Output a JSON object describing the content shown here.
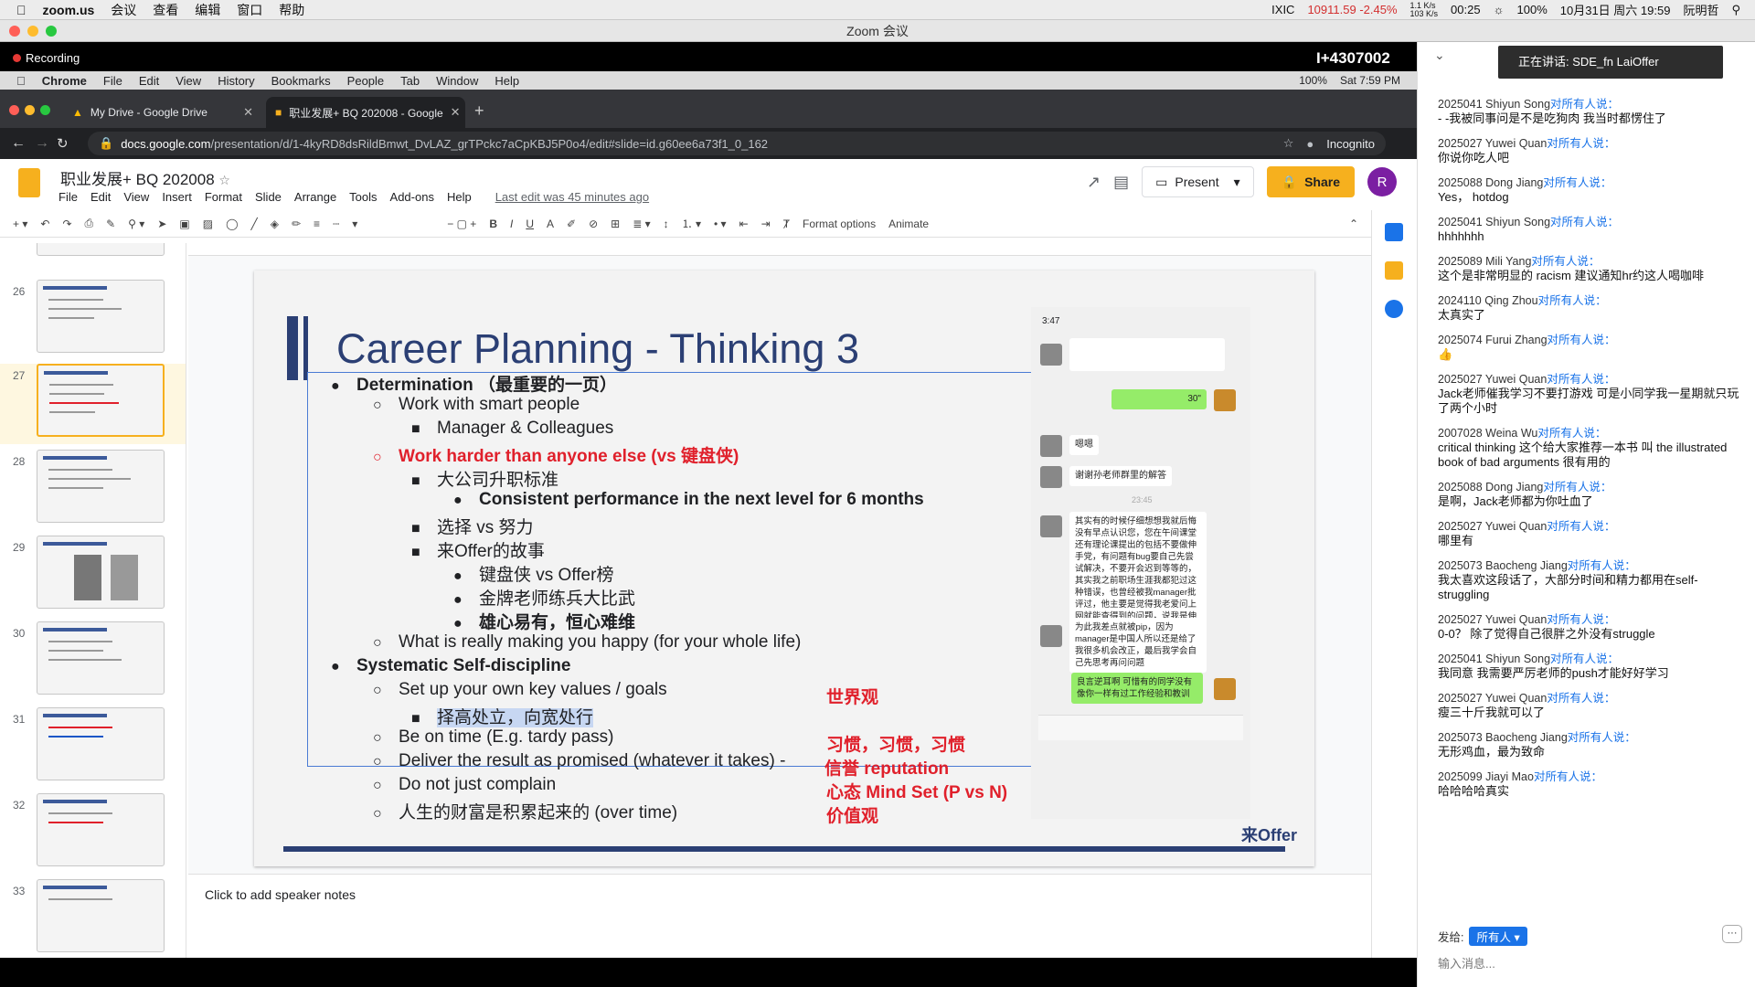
{
  "mac_menu": {
    "app": "zoom.us",
    "items": [
      "会议",
      "查看",
      "编辑",
      "窗口",
      "帮助"
    ],
    "ixic_label": "IXIC",
    "ixic_value": "10911.59 -2.45%",
    "net_up": "1.1 K/s",
    "net_down": "103 K/s",
    "timer": "00:25",
    "battery": "100%",
    "datetime": "10月31日 周六 19:59",
    "user": "阮明哲"
  },
  "zoom": {
    "window_title": "Zoom 会议",
    "recording": "Recording",
    "meeting_id": "I+4307002",
    "speaking": "正在讲话: SDE_fn LaiOffer"
  },
  "chrome_menu": {
    "app": "Chrome",
    "items": [
      "File",
      "Edit",
      "View",
      "History",
      "Bookmarks",
      "People",
      "Tab",
      "Window",
      "Help"
    ],
    "battery": "100%",
    "clock": "Sat 7:59 PM"
  },
  "tabs": [
    {
      "label": "My Drive - Google Drive"
    },
    {
      "label": "职业发展+ BQ 202008 - Google"
    }
  ],
  "url": {
    "host": "docs.google.com",
    "path": "/presentation/d/1-4kyRD8dsRildBmwt_DvLAZ_grTPckc7aCpKBJ5P0o4/edit#slide=id.g60ee6a73f1_0_162",
    "incognito": "Incognito"
  },
  "doc": {
    "title": "职业发展+ BQ 202008",
    "menus": [
      "File",
      "Edit",
      "View",
      "Insert",
      "Format",
      "Slide",
      "Arrange",
      "Tools",
      "Add-ons",
      "Help"
    ],
    "last_edit": "Last edit was 45 minutes ago",
    "present": "Present",
    "share": "Share",
    "avatar": "R"
  },
  "toolbar": {
    "format_options": "Format options",
    "animate": "Animate"
  },
  "filmstrip": [
    {
      "num": "26",
      "title": "Career Planning - Thinking 3"
    },
    {
      "num": "27",
      "title": "Career Planning - Thinking 3"
    },
    {
      "num": "28",
      "title": "Career Planning - Thinking 4"
    },
    {
      "num": "29",
      "title": "Career Planning - Thinking 4"
    },
    {
      "num": "30",
      "title": "Career Planning - Taking"
    },
    {
      "num": "31",
      "title": "Career Planning - Execution 1"
    },
    {
      "num": "32",
      "title": "Career Planning - Execution 1"
    },
    {
      "num": "33",
      "title": "Career Planning - Execution 2"
    }
  ],
  "slide": {
    "title": "Career Planning - Thinking 3",
    "lines": [
      {
        "marker": "●",
        "text": "Determination （最重要的一页）"
      },
      {
        "marker": "○",
        "text": "Work with smart people"
      },
      {
        "marker": "■",
        "text": "Manager & Colleagues"
      },
      {
        "marker": "○",
        "text": "Work harder than anyone else (vs 键盘侠)"
      },
      {
        "marker": "■",
        "text": "大公司升职标准"
      },
      {
        "marker": "●",
        "text": "Consistent performance in the next level for 6 months"
      },
      {
        "marker": "■",
        "text": "选择 vs 努力"
      },
      {
        "marker": "■",
        "text": "来Offer的故事"
      },
      {
        "marker": "●",
        "text": "键盘侠 vs Offer榜"
      },
      {
        "marker": "●",
        "text": "金牌老师练兵大比武"
      },
      {
        "marker": "●",
        "text": "雄心易有，恒心难维"
      },
      {
        "marker": "○",
        "text": "What is really making you happy (for your whole life)"
      },
      {
        "marker": "●",
        "text": "Systematic Self-discipline"
      },
      {
        "marker": "○",
        "text": "Set up your own key values / goals"
      },
      {
        "marker": "■",
        "text": "择高处立，向宽处行"
      },
      {
        "marker": "○",
        "text": "Be on time (E.g. tardy pass)"
      },
      {
        "marker": "○",
        "text": "Deliver the result as promised (whatever it takes) -"
      },
      {
        "marker": "○",
        "text": "Do not just complain"
      },
      {
        "marker": "○",
        "pre": "人生的",
        "w1": "财富",
        "mid": "是",
        "w2": "积累",
        "post": "起来的 (over time)"
      }
    ],
    "tags": [
      "世界观",
      "习惯，习惯，习惯",
      "信誉 reputation",
      "心态 Mind Set (P vs N)",
      "价值观"
    ],
    "phone": {
      "time": "3:47",
      "sent": "30\"",
      "m1": "嗯嗯",
      "m2": "谢谢孙老师群里的解答",
      "stamp": "23:45",
      "m3": "其实有的时候仔细想想我就后悔没有早点认识您，您在午间课堂还有理论课提出的包括不要做伸手党，有问题有bug要自己先尝试解决，不要开会迟到等等的，其实我之前职场生涯我都犯过这种错误，也曾经被我manager批评过，他主要是觉得我老爱问上网就能查得到的问题，说我是伸手党",
      "m4": "为此我差点就被pip，因为manager是中国人所以还是给了我很多机会改正，最后我学会自己先思考再问问题",
      "m5": "良言逆耳啊 可惜有的同学没有像你一样有过工作经验和教训"
    },
    "logo": "来Offer"
  },
  "notes": "Click to add speaker notes",
  "chat": {
    "messages": [
      {
        "who": "2025041 Shiyun Song",
        "txt": "- -我被同事问是不是吃狗肉 我当时都愣住了"
      },
      {
        "who": "2025027 Yuwei Quan",
        "txt": "你说你吃人吧"
      },
      {
        "who": "2025088 Dong Jiang",
        "txt": "Yes， hotdog"
      },
      {
        "who": "2025041 Shiyun Song",
        "txt": "hhhhhhh"
      },
      {
        "who": "2025089 Mili Yang",
        "txt": "这个是非常明显的 racism 建议通知hr约这人喝咖啡"
      },
      {
        "who": "2024110 Qing Zhou",
        "txt": "太真实了"
      },
      {
        "who": "2025074 Furui Zhang",
        "txt": "👍"
      },
      {
        "who": "2025027 Yuwei Quan",
        "txt": "Jack老师催我学习不要打游戏 可是小同学我一星期就只玩了两个小时"
      },
      {
        "who": "2007028 Weina Wu",
        "txt": "critical thinking 这个给大家推荐一本书 叫 the illustrated book of bad arguments 很有用的"
      },
      {
        "who": "2025088 Dong Jiang",
        "txt": "是啊，Jack老师都为你吐血了"
      },
      {
        "who": "2025027 Yuwei Quan",
        "txt": "哪里有"
      },
      {
        "who": "2025073 Baocheng Jiang",
        "txt": "我太喜欢这段话了，大部分时间和精力都用在self-struggling"
      },
      {
        "who": "2025027 Yuwei Quan",
        "txt": "0-0？ 除了觉得自己很胖之外没有struggle"
      },
      {
        "who": "2025041 Shiyun Song",
        "txt": "我同意 我需要严厉老师的push才能好好学习"
      },
      {
        "who": "2025027 Yuwei Quan",
        "txt": "瘦三十斤我就可以了"
      },
      {
        "who": "2025073 Baocheng Jiang",
        "txt": "无形鸡血，最为致命"
      },
      {
        "who": "2025099 Jiayi Mao",
        "txt": "哈哈哈哈真实"
      }
    ],
    "to_all": "对所有人说：",
    "send_to": "发给:",
    "recipient": "所有人",
    "input_placeholder": "输入消息..."
  },
  "colors": {
    "accent_blue": "#1a73e8",
    "slide_navy": "#2b3f74",
    "red_text": "#e0202b",
    "share_yellow": "#f6b01e"
  }
}
